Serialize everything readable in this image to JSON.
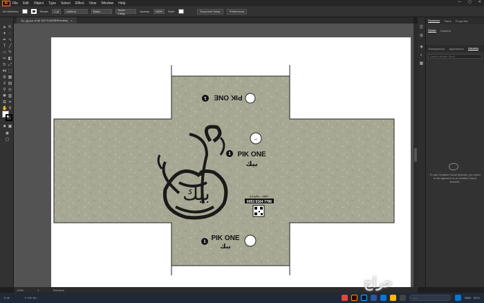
{
  "menu": {
    "app_logo": "Ai",
    "items": [
      "File",
      "Edit",
      "Object",
      "Type",
      "Select",
      "Effect",
      "View",
      "Window",
      "Help"
    ],
    "window_controls": [
      "—",
      "▢",
      "✕"
    ]
  },
  "control": {
    "selection_label": "No Selection",
    "stroke_label": "Stroke:",
    "stroke_value": "1 pt",
    "uniform_label": "Uniform",
    "brush_label": "Basic",
    "style_label": "Touch Callig...",
    "opacity_label": "Opacity:",
    "opacity_value": "100%",
    "style2_label": "Style:",
    "doc_setup_btn": "Document Setup",
    "prefs_btn": "Preferences"
  },
  "doc_tab": {
    "title": "صندوق بيك.ai @ 100 % (RGB/Preview)",
    "close": "×"
  },
  "panel": {
    "top_tabs": [
      "Swatches",
      "Paths",
      "Properties"
    ],
    "sub_tabs": [
      "Stroke",
      "Gradient"
    ],
    "row3_tabs": [
      "Transparency",
      "Appearance",
      "Libraries"
    ],
    "search_placeholder": "Search Adobe Stock",
    "cc_message": "To use Creative Cloud libraries, you need to be signed in to a Creative Cloud account."
  },
  "status": {
    "zoom": "100%",
    "artboard_index": "1",
    "mode": "Selection"
  },
  "artwork": {
    "brand": "PIK ONE",
    "arabic_brand": "بيك",
    "badge_number": "1",
    "order_label": "للطلب والتواصل",
    "phone": "0053 9164 7796",
    "seal_label": "ختم"
  },
  "taskbar": {
    "search_placeholder": "بحث",
    "time": "٢:١٨",
    "date": "٢٠٢٤/٠٨/١٠",
    "weather": "31°C",
    "lang": "ENG"
  },
  "watermark": {
    "text": "حراج"
  },
  "colors": {
    "box_fill": "#a7a893",
    "accent": "#ff9a00"
  }
}
